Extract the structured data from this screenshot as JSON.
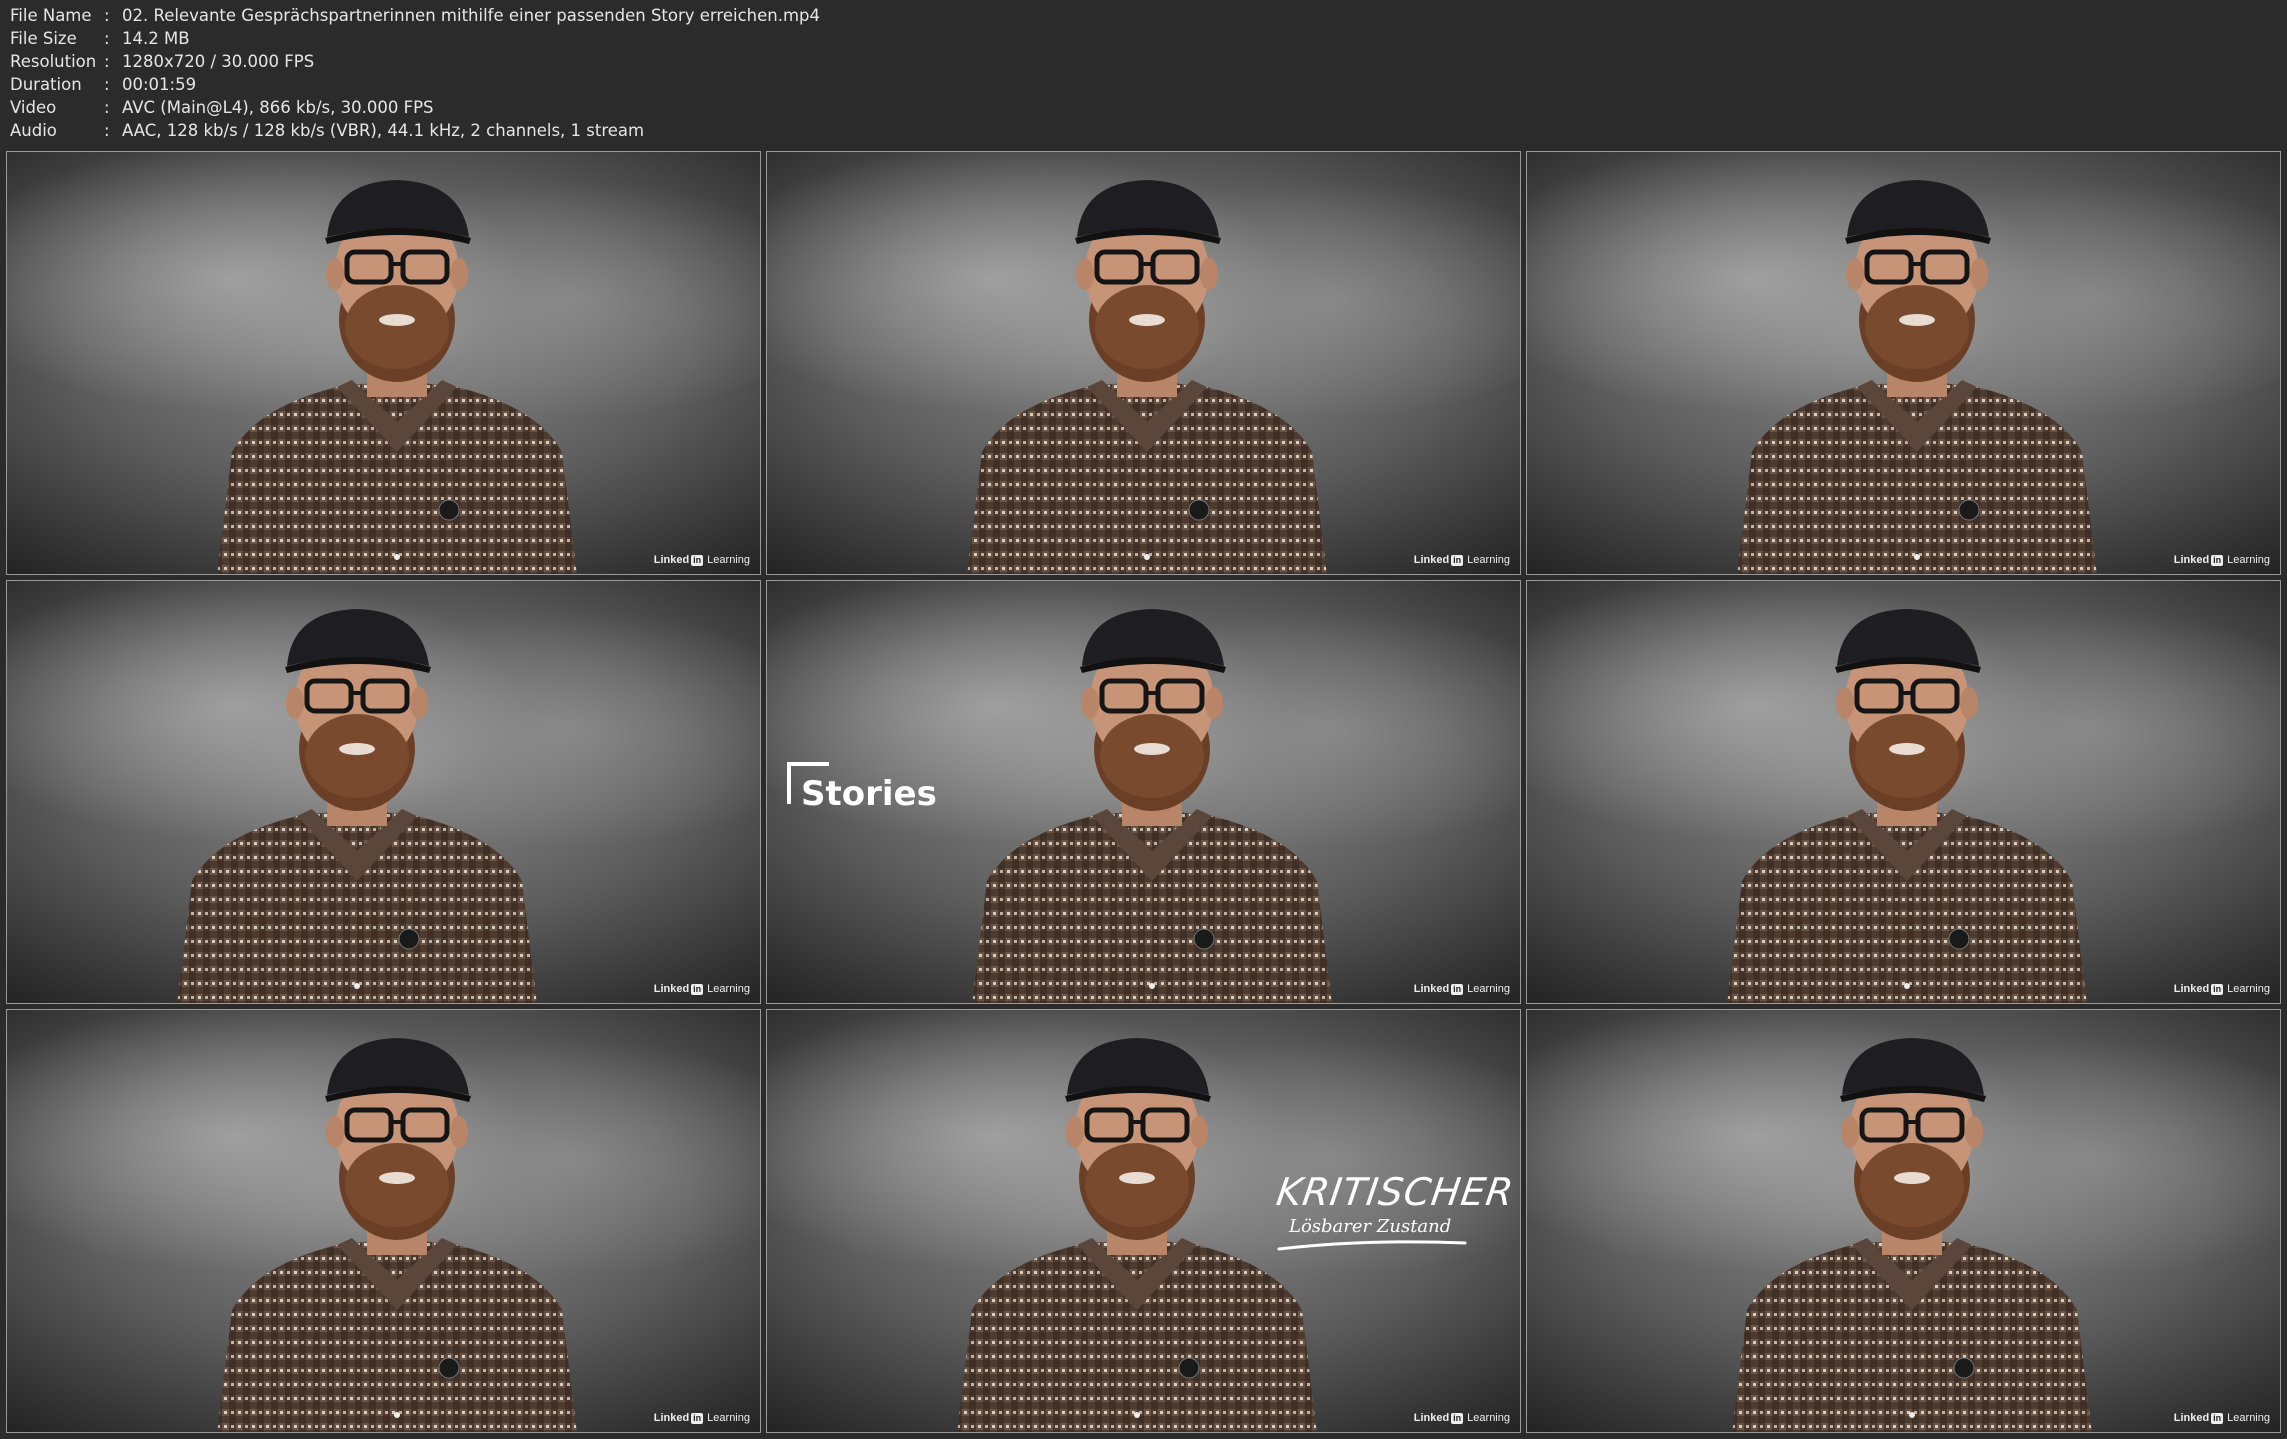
{
  "info": {
    "rows": [
      {
        "label": "File Name",
        "value": "02. Relevante Gesprächspartnerinnen mithilfe einer passenden Story erreichen.mp4"
      },
      {
        "label": "File Size",
        "value": "14.2 MB"
      },
      {
        "label": "Resolution",
        "value": "1280x720 / 30.000 FPS"
      },
      {
        "label": "Duration",
        "value": "00:01:59"
      },
      {
        "label": "Video",
        "value": "AVC (Main@L4), 866 kb/s, 30.000 FPS"
      },
      {
        "label": "Audio",
        "value": "AAC, 128 kb/s / 128 kb/s (VBR), 44.1 kHz, 2 channels, 1 stream"
      }
    ],
    "separator": ":"
  },
  "watermark": {
    "linked": "Linked",
    "in": "in",
    "learning": "Learning"
  },
  "overlays": {
    "stories": "Stories",
    "kritischer": "KRITISCHER",
    "loesbarer": "Lösbarer Zustand"
  },
  "colors": {
    "page_bg": "#2b2b2b",
    "text": "#e6e6e6",
    "frame_border": "#9a9a9a"
  }
}
